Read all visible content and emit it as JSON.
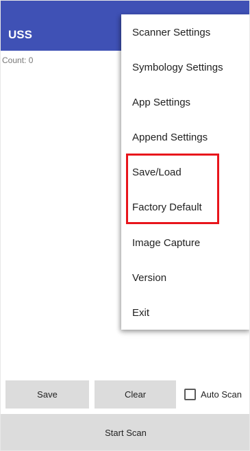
{
  "appbar": {
    "title": "USS",
    "color": "#3f51b5"
  },
  "main": {
    "count_label": "Count:  0"
  },
  "menu": {
    "items": [
      {
        "label": "Scanner Settings"
      },
      {
        "label": "Symbology Settings"
      },
      {
        "label": "App Settings"
      },
      {
        "label": "Append Settings"
      },
      {
        "label": "Save/Load"
      },
      {
        "label": "Factory Default"
      },
      {
        "label": "Image Capture"
      },
      {
        "label": "Version"
      },
      {
        "label": "Exit"
      }
    ]
  },
  "highlight": {
    "color": "#e8141b",
    "covers": [
      "Save/Load",
      "Factory Default"
    ]
  },
  "bottom": {
    "save_label": "Save",
    "clear_label": "Clear",
    "auto_scan_label": "Auto Scan",
    "auto_scan_checked": false,
    "start_scan_label": "Start Scan"
  }
}
